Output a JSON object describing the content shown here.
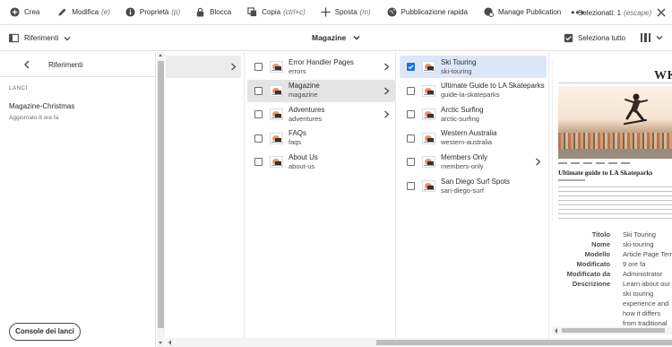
{
  "actionbar": {
    "actions": [
      {
        "label": "Crea",
        "shortcut": "",
        "icon": "add-circle-icon"
      },
      {
        "label": "Modifica",
        "shortcut": "(e)",
        "icon": "pencil-icon"
      },
      {
        "label": "Proprietà",
        "shortcut": "(p)",
        "icon": "info-icon"
      },
      {
        "label": "Blocca",
        "shortcut": "",
        "icon": "lock-icon"
      },
      {
        "label": "Copia",
        "shortcut": "(ctrl+c)",
        "icon": "copy-icon"
      },
      {
        "label": "Sposta",
        "shortcut": "(m)",
        "icon": "move-icon"
      },
      {
        "label": "Pubblicazione rapida",
        "shortcut": "",
        "icon": "globe-icon"
      },
      {
        "label": "Manage Publication",
        "shortcut": "",
        "icon": "globe-gear-icon"
      }
    ],
    "more_label": "•••",
    "selection_label": "Selezionati: 1",
    "selection_shortcut": "(escape)"
  },
  "toolbar": {
    "rail_label": "Riferimenti",
    "breadcrumb": "Magazine",
    "select_all": "Seleziona tutto"
  },
  "rail": {
    "title": "Riferimenti",
    "section": "LANCI",
    "launch": {
      "name": "Magazine-Christmas",
      "updated": "Aggiornato 8 ore fa"
    },
    "console_button": "Console dei lanci"
  },
  "columns": {
    "col1": [
      {
        "title": "Error Handler Pages",
        "name": "errors",
        "has_children": true,
        "state": "normal"
      },
      {
        "title": "Magazine",
        "name": "magazine",
        "has_children": true,
        "state": "parent"
      },
      {
        "title": "Adventures",
        "name": "adventures",
        "has_children": true,
        "state": "normal"
      },
      {
        "title": "FAQs",
        "name": "faqs",
        "has_children": false,
        "state": "normal"
      },
      {
        "title": "About Us",
        "name": "about-us",
        "has_children": false,
        "state": "normal"
      }
    ],
    "col2": [
      {
        "title": "Ski Touring",
        "name": "ski-touring",
        "has_children": false,
        "state": "selected"
      },
      {
        "title": "Ultimate Guide to LA Skateparks",
        "name": "guide-la-skateparks",
        "has_children": false,
        "state": "normal"
      },
      {
        "title": "Arctic Surfing",
        "name": "arctic-surfing",
        "has_children": false,
        "state": "normal"
      },
      {
        "title": "Western Australia",
        "name": "western-australia",
        "has_children": false,
        "state": "normal"
      },
      {
        "title": "Members Only",
        "name": "members-only",
        "has_children": true,
        "state": "normal"
      },
      {
        "title": "San Diego Surf Spots",
        "name": "san-diego-surf",
        "has_children": false,
        "state": "normal"
      }
    ]
  },
  "preview": {
    "logo": "WKI",
    "headline": "Ultimate guide to LA Skateparks"
  },
  "properties": [
    {
      "key": "Titolo",
      "value": "Ski Touring"
    },
    {
      "key": "Nome",
      "value": "ski-touring"
    },
    {
      "key": "Modello",
      "value": "Article Page Templ"
    },
    {
      "key": "Modificato",
      "value": "9 ore fa"
    },
    {
      "key": "Modificato da",
      "value": "Administrator"
    },
    {
      "key": "Descrizione",
      "value": "Learn about our ski touring experience and how it differs from traditional downhill skiing and"
    }
  ]
}
